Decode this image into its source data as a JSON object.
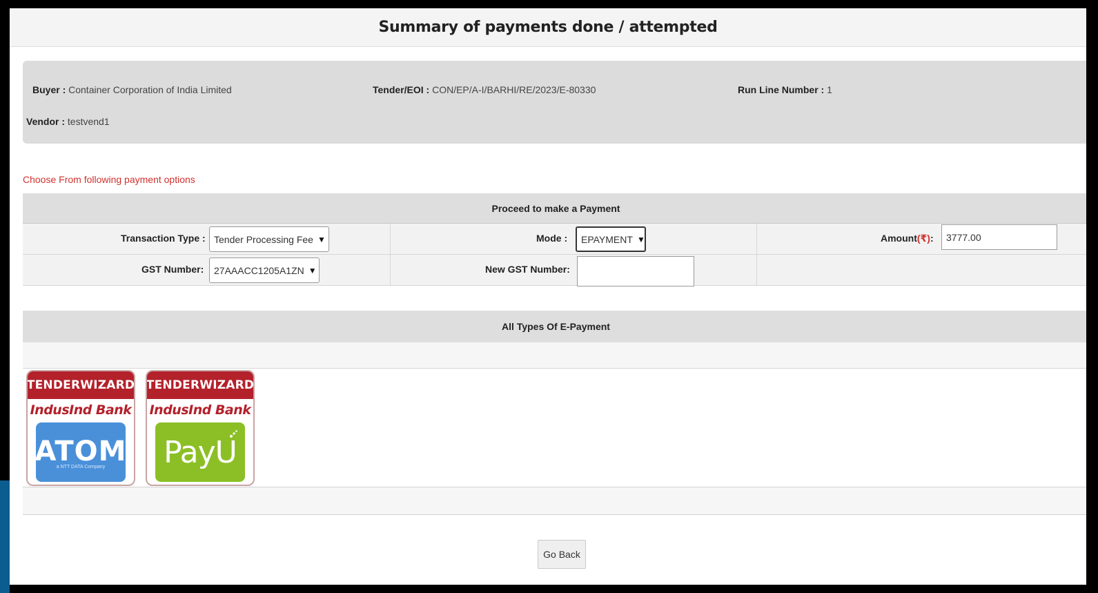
{
  "header": {
    "title": "Summary of payments done / attempted"
  },
  "info": {
    "buyer_label": "Buyer :",
    "buyer_value": "Container Corporation of India Limited",
    "tender_label": "Tender/EOI :",
    "tender_value": "CON/EP/A-I/BARHI/RE/2023/E-80330",
    "run_line_label": "Run Line Number :",
    "run_line_value": "1",
    "vendor_label": "Vendor :",
    "vendor_value": "testvend1"
  },
  "choose_text": "Choose From following payment options",
  "payment_form": {
    "heading": "Proceed to make a Payment",
    "transaction_type_label": "Transaction Type :",
    "transaction_type_value": "Tender Processing Fee",
    "mode_label": "Mode :",
    "mode_value": "EPAYMENT",
    "amount_label_prefix": "Amount",
    "amount_label_currency": "(₹)",
    "amount_label_suffix": ":",
    "amount_value": "3777.00",
    "gst_label": "GST Number:",
    "gst_value": "27AAACC1205A1ZN",
    "new_gst_label": "New GST Number:",
    "new_gst_value": ""
  },
  "epayment": {
    "heading": "All Types Of E-Payment",
    "gateways": [
      {
        "brand": "TENDERWIZARD",
        "bank": "IndusInd Bank",
        "logo": "ATOM",
        "logo_sub": "a NTT DATA Company"
      },
      {
        "brand": "TENDERWIZARD",
        "bank": "IndusInd Bank",
        "logo": "PayU",
        "logo_sub": ""
      }
    ]
  },
  "footer": {
    "go_back_label": "Go Back"
  },
  "colors": {
    "accent_red": "#d0312d",
    "brand_red": "#b3212b",
    "atom_blue": "#4a90d9",
    "payu_green": "#8cbf26"
  }
}
